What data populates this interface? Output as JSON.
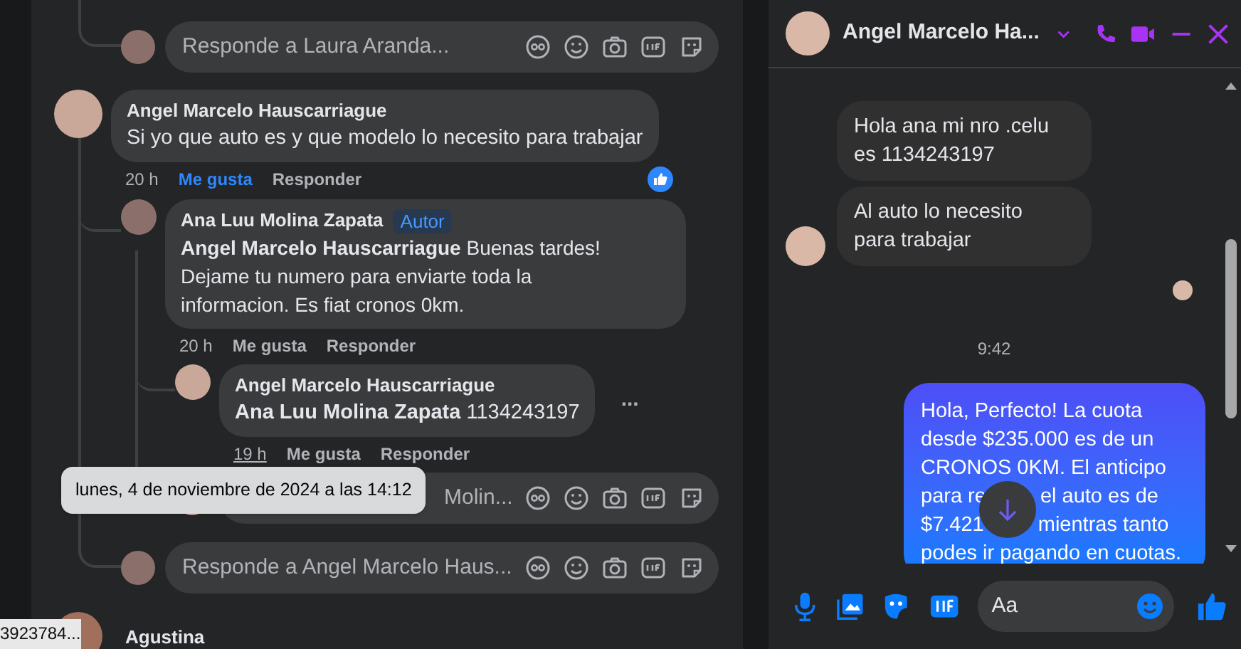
{
  "comments": {
    "reply_box_top": {
      "placeholder": "Responde a Laura Aranda..."
    },
    "comment": {
      "author": "Angel Marcelo Hauscarriague",
      "text": "Si yo que auto es y que modelo lo necesito para trabajar",
      "time": "20 h",
      "like": "Me gusta",
      "liked": true,
      "reply": "Responder",
      "replies": [
        {
          "author": "Ana Luu Molina Zapata",
          "badge": "Autor",
          "text": "**Angel Marcelo Hauscarriague** Buenas tardes! Dejame tu numero para enviarte toda la informacion. Es fiat cronos 0km.",
          "time": "20 h",
          "like": "Me gusta",
          "liked": false,
          "reply": "Responder",
          "replies": [
            {
              "author": "Angel Marcelo Hauscarriague",
              "text": "**Ana Luu Molina Zapata** 1134243197",
              "time": "19 h",
              "like": "Me gusta",
              "liked": false,
              "reply": "Responder",
              "more": "..."
            }
          ]
        }
      ]
    },
    "reply_box_nested": {
      "placeholder": "Molin..."
    },
    "date_tooltip": "lunes, 4 de noviembre de 2024 a las 14:12",
    "reply_box_bottom": {
      "placeholder": "Responde a Angel Marcelo Haus..."
    },
    "next_comment": {
      "author": "Agustina"
    },
    "link_tooltip": "3923784..."
  },
  "chat": {
    "title": "Angel Marcelo Ha...",
    "incoming": [
      {
        "text": "Hola ana mi nro .celu es 1134243197"
      },
      {
        "text": "Al auto lo necesito para trabajar"
      }
    ],
    "timestamp": "9:42",
    "outgoing": {
      "lines": [
        [
          "Hola, Perfecto! La cuota"
        ],
        [
          "desde $235.000 es de un"
        ],
        [
          "CRONOS 0KM. El anticipo"
        ],
        [
          "para re",
          "el auto es de"
        ],
        [
          "$7.421",
          "mientras tanto"
        ],
        [
          "podes ir pagando en cuotas."
        ]
      ]
    },
    "composer": {
      "placeholder": "Aa"
    }
  }
}
